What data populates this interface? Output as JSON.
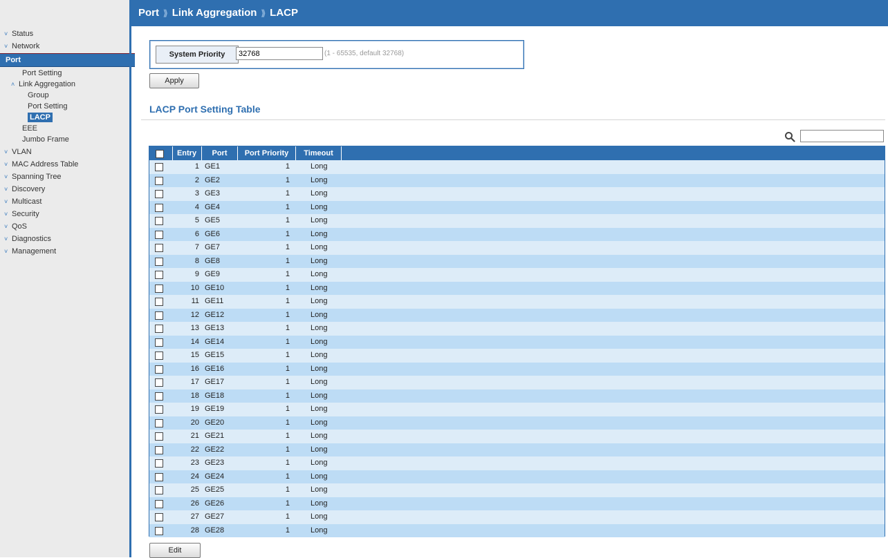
{
  "breadcrumb": {
    "level1": "Port",
    "level2": "Link Aggregation",
    "level3": "LACP",
    "separator": "⟫"
  },
  "sidebar": {
    "status": "Status",
    "network": "Network",
    "port": "Port",
    "port_setting": "Port Setting",
    "link_aggregation": "Link Aggregation",
    "group": "Group",
    "la_port_setting": "Port Setting",
    "lacp": "LACP",
    "eee": "EEE",
    "jumbo_frame": "Jumbo Frame",
    "vlan": "VLAN",
    "mac_address_table": "MAC Address Table",
    "spanning_tree": "Spanning Tree",
    "discovery": "Discovery",
    "multicast": "Multicast",
    "security": "Security",
    "qos": "QoS",
    "diagnostics": "Diagnostics",
    "management": "Management",
    "collapsed_chevron": "˅",
    "expanded_chevron": "˄"
  },
  "system_priority": {
    "label": "System Priority",
    "value": "32768",
    "hint": "(1 - 65535, default 32768)"
  },
  "buttons": {
    "apply": "Apply",
    "edit": "Edit"
  },
  "table": {
    "title": "LACP Port Setting Table",
    "search_value": "",
    "columns": [
      "Entry",
      "Port",
      "Port Priority",
      "Timeout"
    ],
    "rows": [
      {
        "entry": "1",
        "port": "GE1",
        "priority": "1",
        "timeout": "Long"
      },
      {
        "entry": "2",
        "port": "GE2",
        "priority": "1",
        "timeout": "Long"
      },
      {
        "entry": "3",
        "port": "GE3",
        "priority": "1",
        "timeout": "Long"
      },
      {
        "entry": "4",
        "port": "GE4",
        "priority": "1",
        "timeout": "Long"
      },
      {
        "entry": "5",
        "port": "GE5",
        "priority": "1",
        "timeout": "Long"
      },
      {
        "entry": "6",
        "port": "GE6",
        "priority": "1",
        "timeout": "Long"
      },
      {
        "entry": "7",
        "port": "GE7",
        "priority": "1",
        "timeout": "Long"
      },
      {
        "entry": "8",
        "port": "GE8",
        "priority": "1",
        "timeout": "Long"
      },
      {
        "entry": "9",
        "port": "GE9",
        "priority": "1",
        "timeout": "Long"
      },
      {
        "entry": "10",
        "port": "GE10",
        "priority": "1",
        "timeout": "Long"
      },
      {
        "entry": "11",
        "port": "GE11",
        "priority": "1",
        "timeout": "Long"
      },
      {
        "entry": "12",
        "port": "GE12",
        "priority": "1",
        "timeout": "Long"
      },
      {
        "entry": "13",
        "port": "GE13",
        "priority": "1",
        "timeout": "Long"
      },
      {
        "entry": "14",
        "port": "GE14",
        "priority": "1",
        "timeout": "Long"
      },
      {
        "entry": "15",
        "port": "GE15",
        "priority": "1",
        "timeout": "Long"
      },
      {
        "entry": "16",
        "port": "GE16",
        "priority": "1",
        "timeout": "Long"
      },
      {
        "entry": "17",
        "port": "GE17",
        "priority": "1",
        "timeout": "Long"
      },
      {
        "entry": "18",
        "port": "GE18",
        "priority": "1",
        "timeout": "Long"
      },
      {
        "entry": "19",
        "port": "GE19",
        "priority": "1",
        "timeout": "Long"
      },
      {
        "entry": "20",
        "port": "GE20",
        "priority": "1",
        "timeout": "Long"
      },
      {
        "entry": "21",
        "port": "GE21",
        "priority": "1",
        "timeout": "Long"
      },
      {
        "entry": "22",
        "port": "GE22",
        "priority": "1",
        "timeout": "Long"
      },
      {
        "entry": "23",
        "port": "GE23",
        "priority": "1",
        "timeout": "Long"
      },
      {
        "entry": "24",
        "port": "GE24",
        "priority": "1",
        "timeout": "Long"
      },
      {
        "entry": "25",
        "port": "GE25",
        "priority": "1",
        "timeout": "Long"
      },
      {
        "entry": "26",
        "port": "GE26",
        "priority": "1",
        "timeout": "Long"
      },
      {
        "entry": "27",
        "port": "GE27",
        "priority": "1",
        "timeout": "Long"
      },
      {
        "entry": "28",
        "port": "GE28",
        "priority": "1",
        "timeout": "Long"
      }
    ]
  },
  "colors": {
    "accent": "#2f6fb0",
    "row_even": "#bddcf5",
    "row_odd": "#ddecf8",
    "sidebar_bg": "#ebebeb"
  }
}
